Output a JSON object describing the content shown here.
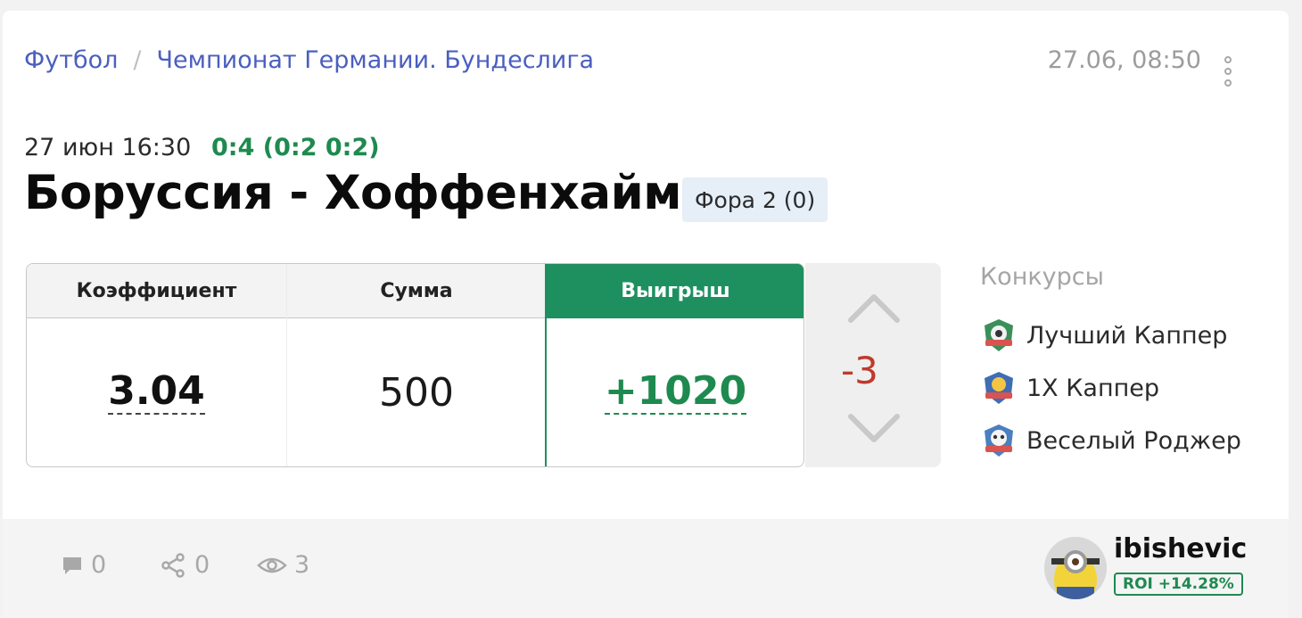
{
  "breadcrumb": {
    "sport": "Футбол",
    "separator": "/",
    "league": "Чемпионат Германии. Бундеслига"
  },
  "post_datetime": "27.06, 08:50",
  "match": {
    "time": "27 июн 16:30",
    "score": "0:4 (0:2 0:2)",
    "title": "Боруссия - Хоффенхайм",
    "bet_type": "Фора 2 (0)"
  },
  "bet": {
    "odds_label": "Коэффициент",
    "odds_value": "3.04",
    "amount_label": "Сумма",
    "amount_value": "500",
    "win_label": "Выигрыш",
    "win_value": "+1020"
  },
  "rating": {
    "value": "-3",
    "color": "#c0392b"
  },
  "contests": {
    "title": "Конкурсы",
    "items": [
      {
        "label": "Лучший Каппер",
        "icon": "trophy-badge-icon"
      },
      {
        "label": "1X Каппер",
        "icon": "shield-badge-icon"
      },
      {
        "label": "Веселый Роджер",
        "icon": "skull-badge-icon"
      }
    ]
  },
  "stats": {
    "comments": "0",
    "shares": "0",
    "views": "3"
  },
  "user": {
    "name": "ibishevic",
    "roi": "ROI +14.28%"
  },
  "colors": {
    "accent_green": "#1e9060",
    "link_blue": "#4a5fbf",
    "negative_red": "#c0392b"
  }
}
